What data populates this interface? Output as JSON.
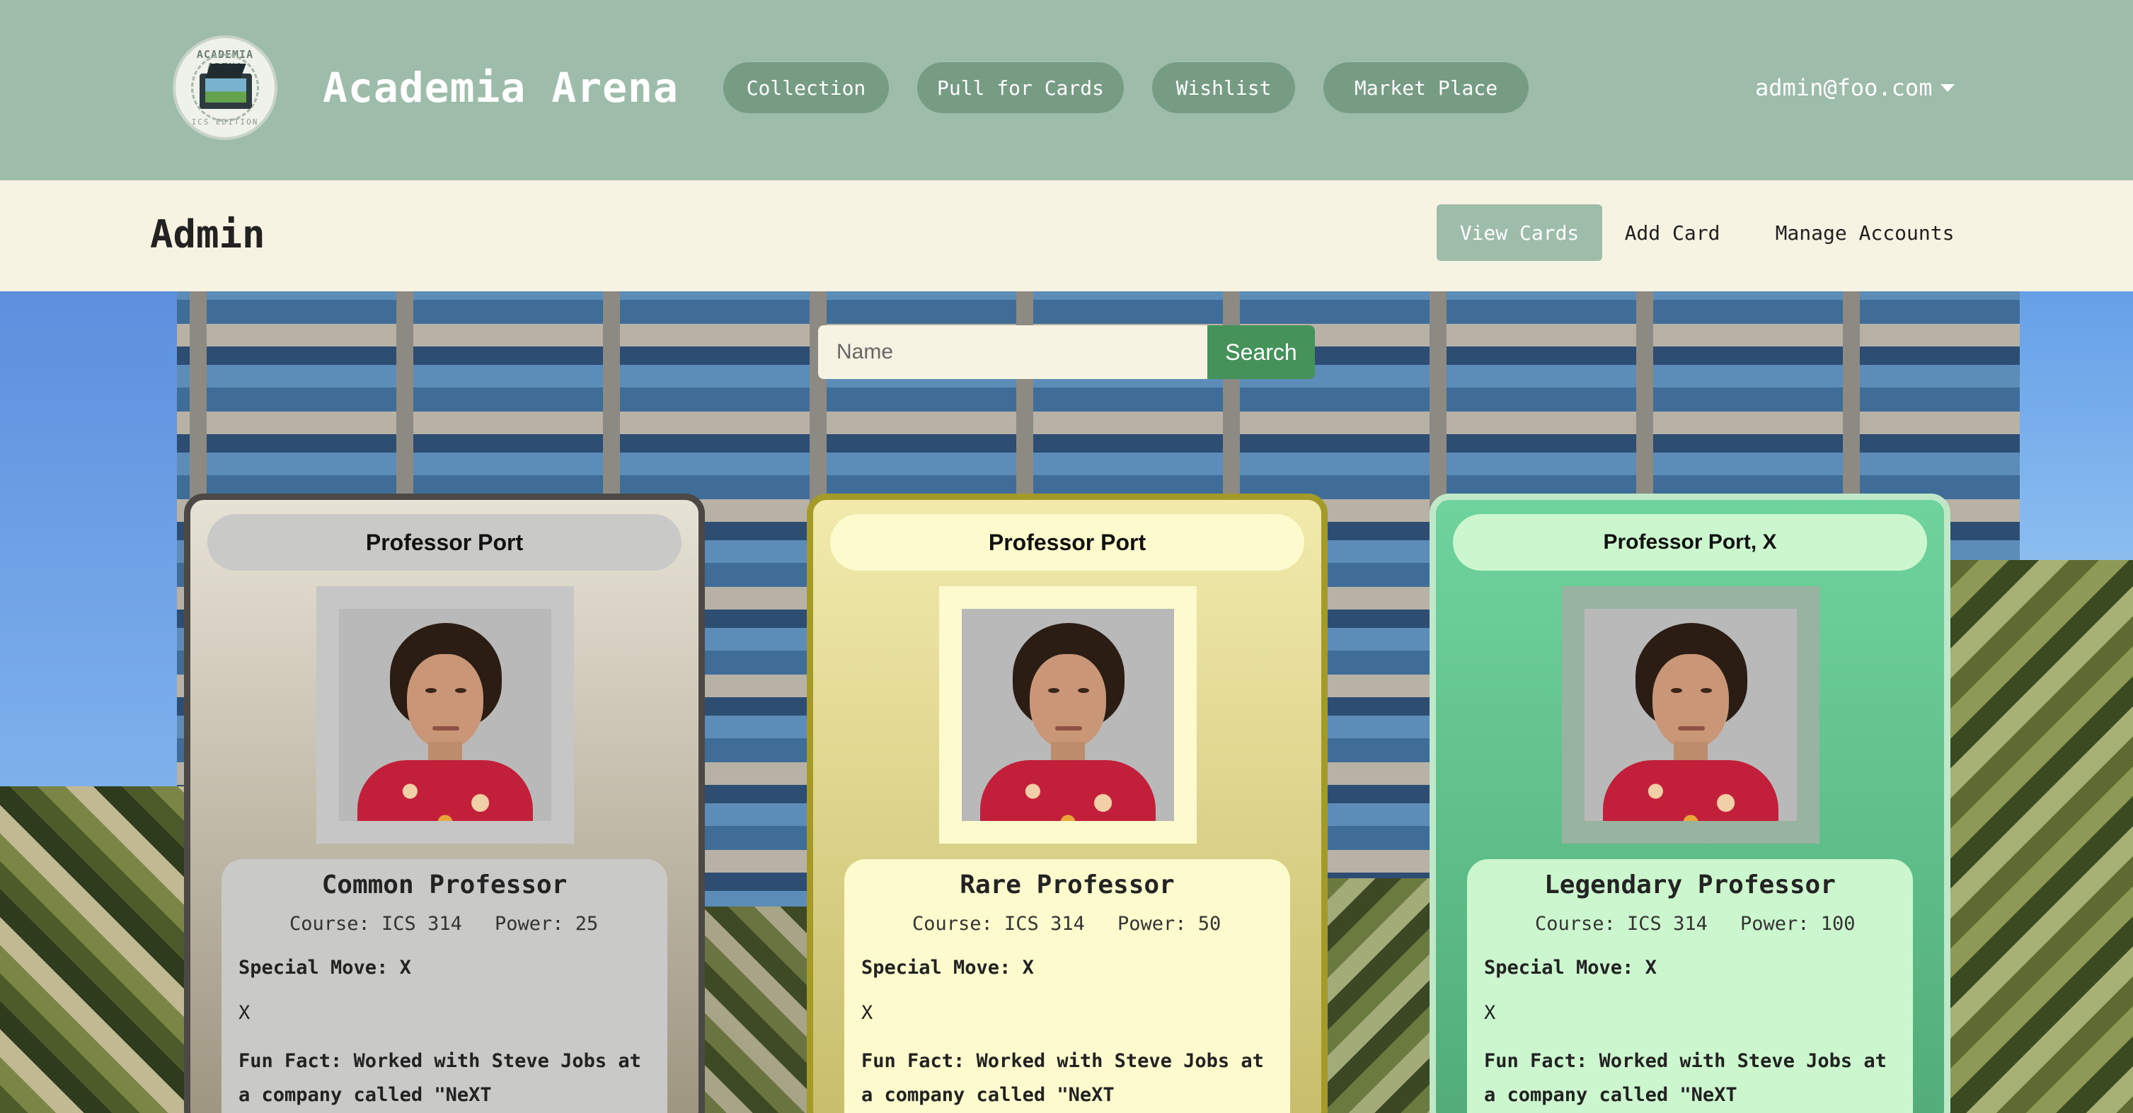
{
  "logo": {
    "text_top": "ACADEMIA ARENA",
    "text_bottom": "ICS EDITION"
  },
  "brand": {
    "title": "Academia Arena"
  },
  "nav": {
    "items": [
      {
        "label": "Collection"
      },
      {
        "label": "Pull for Cards"
      },
      {
        "label": "Wishlist"
      },
      {
        "label": "Market Place"
      }
    ],
    "user_email": "admin@foo.com"
  },
  "subheader": {
    "title": "Admin",
    "tabs": [
      {
        "label": "View Cards",
        "active": true
      },
      {
        "label": "Add Card",
        "active": false
      },
      {
        "label": "Manage Accounts",
        "active": false
      }
    ]
  },
  "search": {
    "placeholder": "Name",
    "value": "",
    "button_label": "Search"
  },
  "cards": [
    {
      "name": "Professor Port",
      "rarity": "Common Professor",
      "course": "Course: ICS 314",
      "power": "Power: 25",
      "special_move": "Special Move: X",
      "special_desc": "X",
      "fun_fact": "Fun Fact: Worked with Steve Jobs at a company called \"NeXT"
    },
    {
      "name": "Professor Port",
      "rarity": "Rare Professor",
      "course": "Course: ICS 314",
      "power": "Power: 50",
      "special_move": "Special Move: X",
      "special_desc": "X",
      "fun_fact": "Fun Fact: Worked with Steve Jobs at a company called \"NeXT"
    },
    {
      "name": "Professor Port, X",
      "rarity": "Legendary Professor",
      "course": "Course: ICS 314",
      "power": "Power: 100",
      "special_move": "Special Move: X",
      "special_desc": "X",
      "fun_fact": "Fun Fact: Worked with Steve Jobs at a company called \"NeXT"
    }
  ],
  "colors": {
    "navbar": "#9dbcaa",
    "nav_pill": "#779c84",
    "subheader": "#f7f3e3",
    "search_button": "#45925b",
    "common": "#c9c9c7",
    "rare": "#fdfbcd",
    "legendary": "#ccf7ce"
  }
}
